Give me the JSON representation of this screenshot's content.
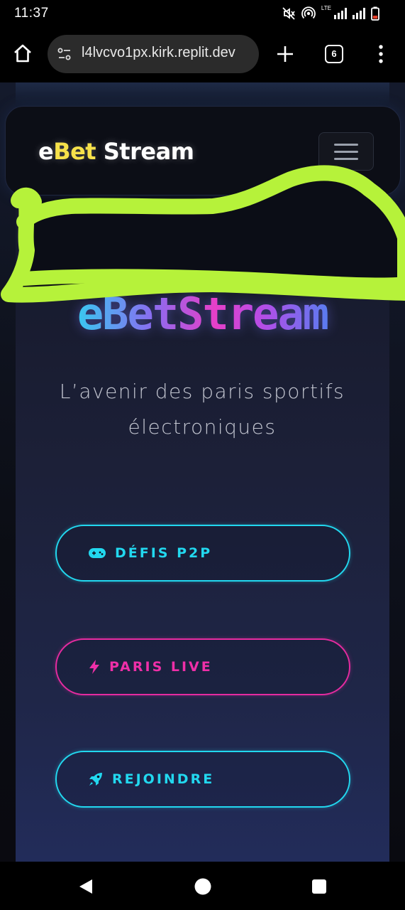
{
  "status_bar": {
    "time": "11:37",
    "network_label": "LTE",
    "icons": [
      "mute-icon",
      "hotspot-icon",
      "signal-icon",
      "signal-icon",
      "battery-icon"
    ]
  },
  "browser": {
    "url": "l4lvcvo1px.kirk.replit.dev",
    "tab_count": "6",
    "icons": [
      "home-icon",
      "site-settings-icon",
      "new-tab-icon",
      "tabs-icon",
      "overflow-menu-icon"
    ]
  },
  "navbar": {
    "brand_e": "e",
    "brand_bet": "Bet",
    "brand_stream": " Stream",
    "menu_icon": "hamburger-icon"
  },
  "hero": {
    "title": "eBetStream",
    "subtitle": "L’avenir des paris sportifs électroniques"
  },
  "buttons": [
    {
      "label": "DÉFIS P2P",
      "icon": "gamepad-icon",
      "color": "#22d8ef"
    },
    {
      "label": "PARIS LIVE",
      "icon": "lightning-icon",
      "color": "#e52ba0"
    },
    {
      "label": "REJOINDRE",
      "icon": "rocket-icon",
      "color": "#22d8ef"
    }
  ],
  "colors": {
    "accent_cyan": "#22d8ef",
    "accent_pink": "#e52ba0",
    "brand_yellow": "#f6e14a",
    "scribble_green": "#b6f23a"
  },
  "nav_bar": {
    "icons": [
      "back-icon",
      "home-circle-icon",
      "recents-icon"
    ]
  }
}
